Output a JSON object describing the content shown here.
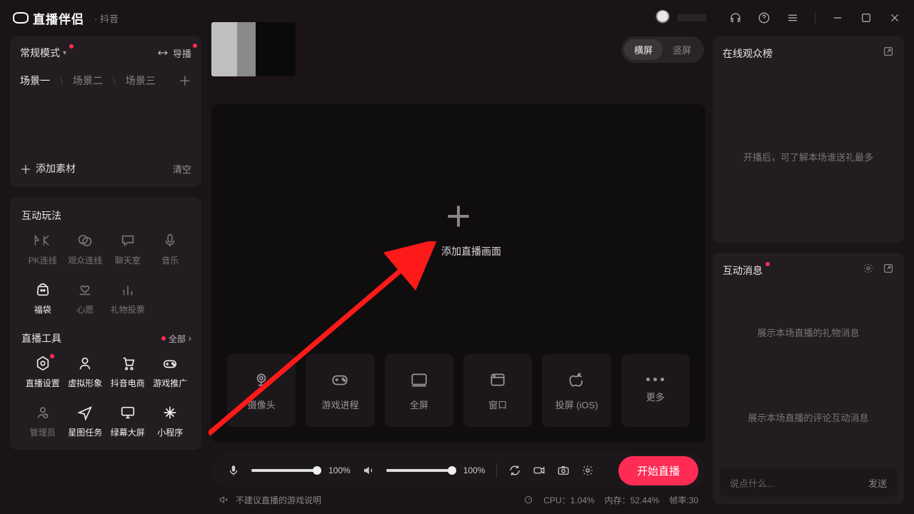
{
  "titlebar": {
    "app": "直播伴侣",
    "sub": "· 抖音"
  },
  "scenes": {
    "mode": "常规模式",
    "guide": "导播",
    "list": [
      "场景一",
      "场景二",
      "场景三"
    ],
    "add_source": "添加素材",
    "clear": "清空"
  },
  "inter": {
    "title": "互动玩法",
    "items": [
      "PK连线",
      "观众连线",
      "聊天室",
      "音乐",
      "福袋",
      "心愿",
      "礼物投票"
    ]
  },
  "tools": {
    "title": "直播工具",
    "all": "全部",
    "items": [
      "直播设置",
      "虚拟形象",
      "抖音电商",
      "游戏推广",
      "管理员",
      "星图任务",
      "绿幕大屏",
      "小程序"
    ]
  },
  "orient": {
    "h": "横屏",
    "v": "竖屏"
  },
  "preview": {
    "add": "添加直播画面"
  },
  "sources": [
    "摄像头",
    "游戏进程",
    "全屏",
    "窗口",
    "投屏 (iOS)",
    "更多"
  ],
  "controls": {
    "mic": "100%",
    "vol": "100%",
    "start": "开始直播"
  },
  "status": {
    "hint": "不建议直播的游戏说明",
    "cpu": "CPU：1.04%",
    "mem": "内存：52.44%",
    "fps": "帧率:30"
  },
  "right": {
    "audience_title": "在线观众榜",
    "audience_hint": "开播后，可了解本场谁送礼最多",
    "msg_title": "互动消息",
    "gift_hint": "展示本场直播的礼物消息",
    "comment_hint": "展示本场直播的评论互动消息",
    "chat_ph": "说点什么...",
    "send": "发送"
  }
}
